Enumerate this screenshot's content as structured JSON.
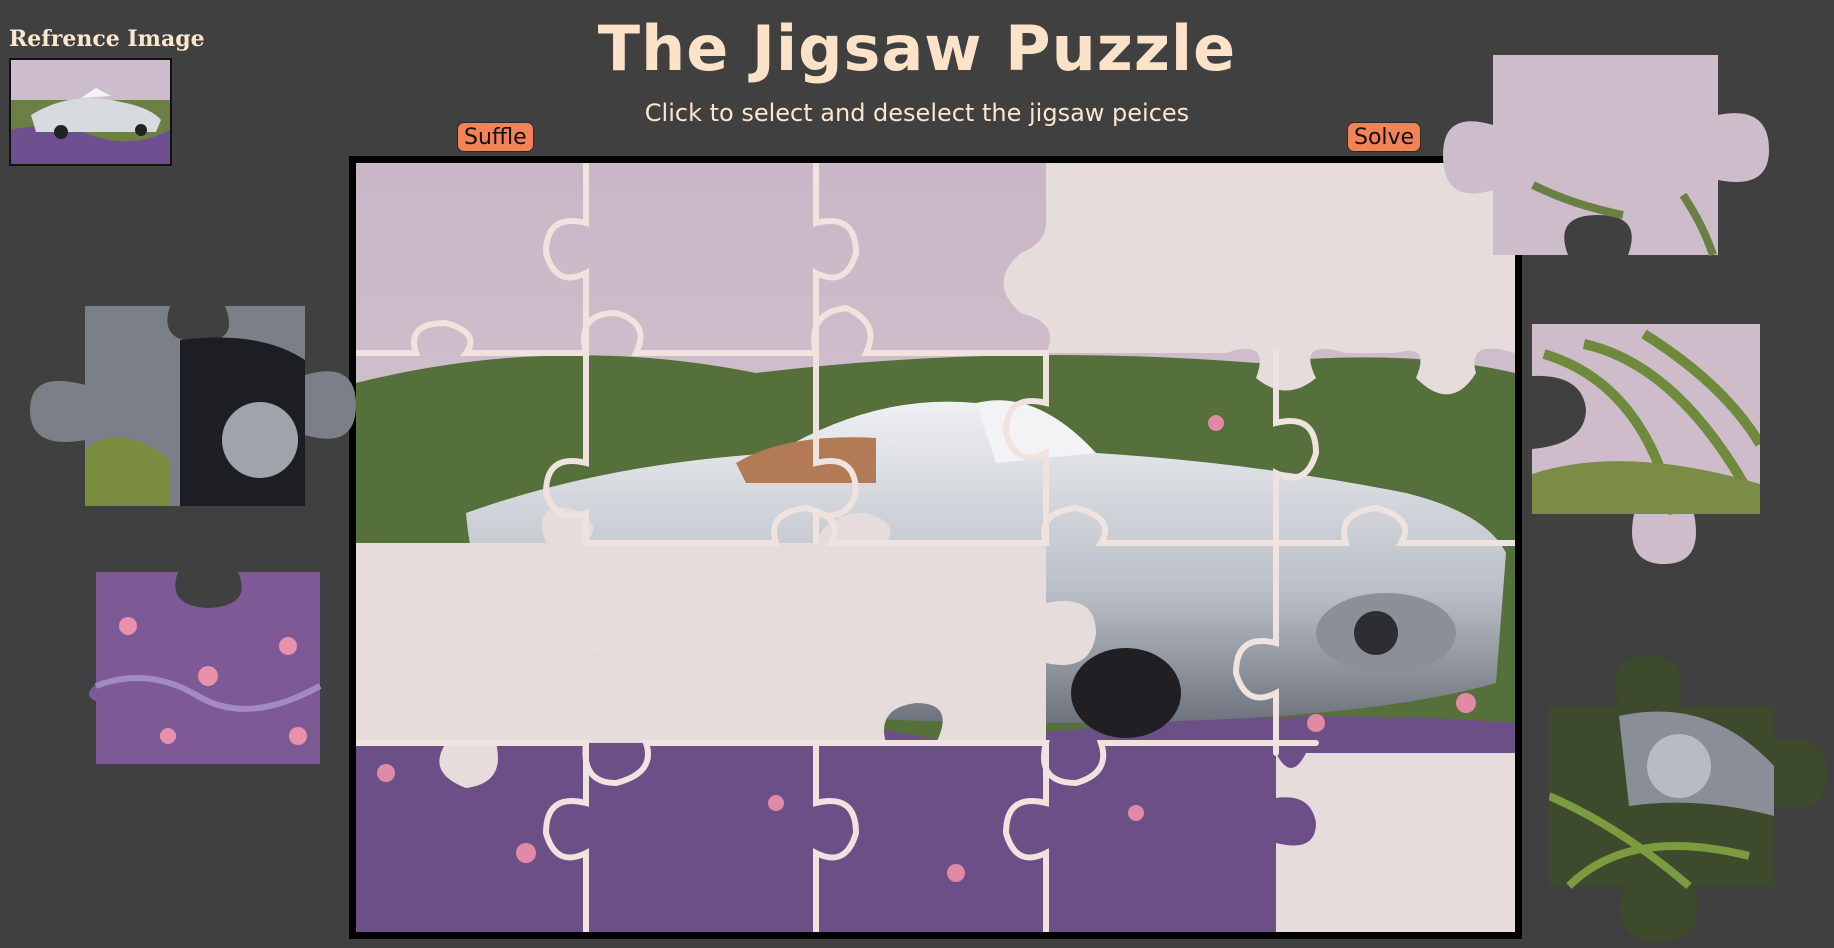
{
  "reference": {
    "title": "Refrence Image"
  },
  "header": {
    "title": "The Jigsaw Puzzle",
    "subtitle": "Click to select and deselect the jigsaw peices"
  },
  "controls": {
    "shuffle_label": "Suffle",
    "solve_label": "Solve"
  },
  "board": {
    "grid": {
      "columns": 5,
      "rows": 4
    },
    "missing_pieces": [
      [
        3,
        0
      ],
      [
        4,
        0
      ],
      [
        0,
        2
      ],
      [
        1,
        2
      ],
      [
        2,
        2
      ],
      [
        4,
        3
      ]
    ]
  },
  "tray": {
    "loose_pieces": 5
  },
  "colors": {
    "background": "#404040",
    "title": "#fbe2c8",
    "button": "#f28357",
    "board_frame": "#000000",
    "empty_slot": "#e7dcdc",
    "piece_outline": "#efe2df"
  }
}
